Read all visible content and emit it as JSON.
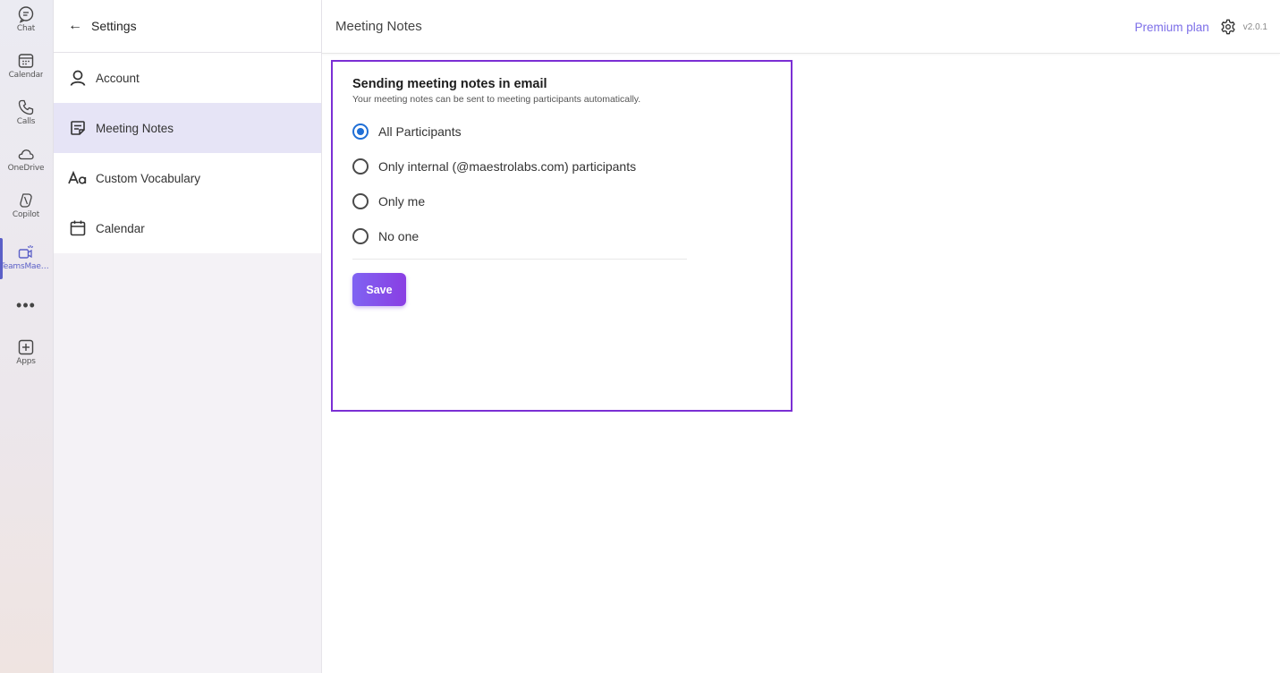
{
  "rail": {
    "items": [
      {
        "label": "Chat",
        "icon": "chat-icon"
      },
      {
        "label": "Calendar",
        "icon": "calendar-icon"
      },
      {
        "label": "Calls",
        "icon": "phone-icon"
      },
      {
        "label": "OneDrive",
        "icon": "cloud-icon"
      },
      {
        "label": "Copilot",
        "icon": "copilot-icon"
      },
      {
        "label": "TeamsMaes...",
        "icon": "teamsmaestro-icon"
      },
      {
        "label": "Apps",
        "icon": "add-apps-icon"
      }
    ],
    "more": "•••",
    "active_color": "#5b5fc7"
  },
  "settings": {
    "back_glyph": "←",
    "title": "Settings",
    "items": [
      {
        "label": "Account",
        "icon": "person-icon"
      },
      {
        "label": "Meeting Notes",
        "icon": "notes-icon"
      },
      {
        "label": "Custom Vocabulary",
        "icon": "text-aa-icon"
      },
      {
        "label": "Calendar",
        "icon": "calendar-icon"
      }
    ],
    "active_index": 1
  },
  "header": {
    "page_title": "Meeting Notes",
    "premium_label": "Premium plan",
    "version": "v2.0.1",
    "accent": "#7c6ee8"
  },
  "card": {
    "title": "Sending meeting notes in email",
    "subtitle": "Your meeting notes can be sent to meeting participants automatically.",
    "options": [
      {
        "label": "All Participants",
        "checked": true
      },
      {
        "label": "Only internal (@maestrolabs.com) participants",
        "checked": false
      },
      {
        "label": "Only me",
        "checked": false
      },
      {
        "label": "No one",
        "checked": false
      }
    ],
    "save_label": "Save",
    "border_color": "#7b2fd4"
  }
}
